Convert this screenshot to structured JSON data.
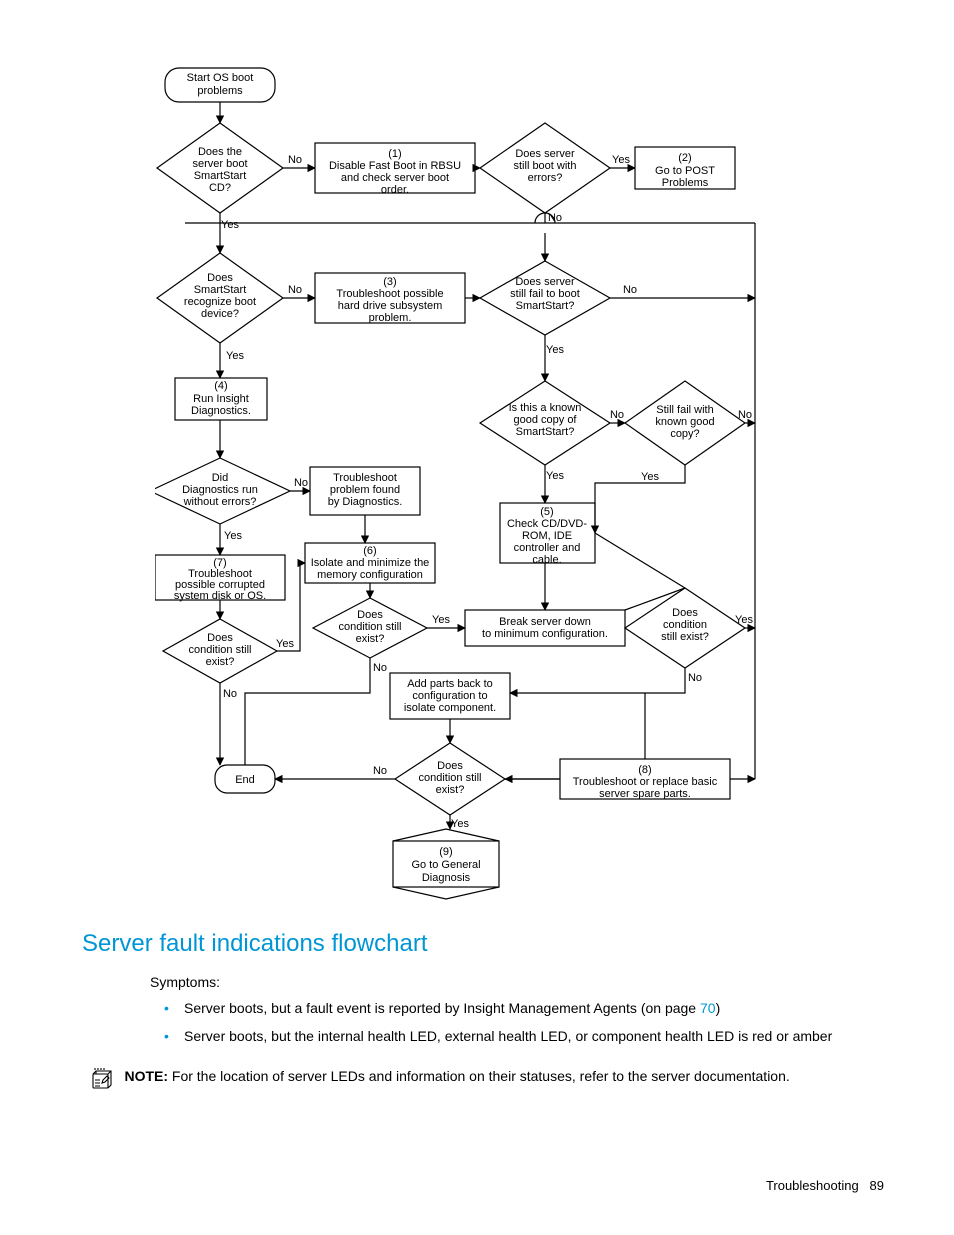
{
  "flow": {
    "start": "Start OS boot problems",
    "q_bootcd": "Does the server boot SmartStart CD?",
    "p1_num": "(1)",
    "p1": "Disable Fast Boot in RBSU and check server boot order.",
    "q_stillerrs": "Does server still boot with errors?",
    "p2_num": "(2)",
    "p2": "Go to POST Problems",
    "q_recog": "Does SmartStart recognize boot device?",
    "p3_num": "(3)",
    "p3": "Troubleshoot possible hard drive subsystem problem.",
    "q_stillfail": "Does server still fail to boot SmartStart?",
    "p4_num": "(4)",
    "p4": "Run Insight Diagnostics.",
    "q_knowngood": "Is this a known good copy of SmartStart?",
    "q_stillknown": "Still fail with known good copy?",
    "q_diagerr": "Did Diagnostics run without errors?",
    "p_diagtrouble": "Troubleshoot problem found by Diagnostics.",
    "p5_num": "(5)",
    "p5": "Check CD/DVD-ROM, IDE controller and cable.",
    "p6_num": "(6)",
    "p6": "Isolate and minimize the memory configuration",
    "p7_num": "(7)",
    "p7": "Troubleshoot possible corrupted system disk or OS.",
    "q_cond6": "Does condition still exist?",
    "q_cond7": "Does condition still exist?",
    "q_cond5": "Does condition still exist?",
    "p_break": "Break server down to minimum configuration.",
    "p_addback": "Add parts back to configuration to isolate component.",
    "end": "End",
    "q_condend": "Does condition still exist?",
    "p8_num": "(8)",
    "p8": "Troubleshoot or replace basic server spare parts.",
    "p9_num": "(9)",
    "p9": "Go to General Diagnosis",
    "yes": "Yes",
    "no": "No"
  },
  "heading": "Server fault indications flowchart",
  "symptoms_label": "Symptoms:",
  "bullets": [
    {
      "pre": "Server boots, but a fault event is reported by Insight Management Agents (on page ",
      "link": "70",
      "post": ")"
    },
    {
      "pre": "Server boots, but the internal health LED, external health LED, or component health LED is red or amber",
      "link": "",
      "post": ""
    }
  ],
  "note": {
    "label": "NOTE:",
    "text": "  For the location of server LEDs and information on their statuses, refer to the server documentation."
  },
  "footer": {
    "section": "Troubleshooting",
    "page": "89"
  }
}
